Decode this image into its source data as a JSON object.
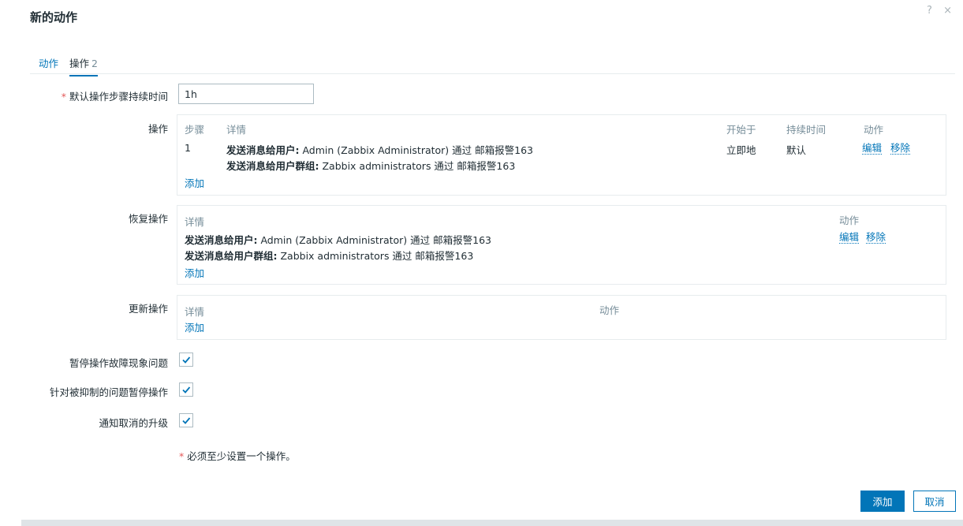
{
  "dialog": {
    "title": "新的动作",
    "help": "?",
    "close": "×"
  },
  "tabs": [
    {
      "label": "动作",
      "count": ""
    },
    {
      "label": "操作",
      "count": "2"
    }
  ],
  "fields": {
    "default_step_duration": {
      "label": "默认操作步骤持续时间",
      "required": "*",
      "value": "1h"
    }
  },
  "operations": {
    "label": "操作",
    "headers": [
      "步骤",
      "详情",
      "开始于",
      "持续时间",
      "动作"
    ],
    "row": {
      "step": "1",
      "detail1_bold": "发送消息给用户:",
      "detail1": " Admin (Zabbix Administrator) 通过 邮箱报警163",
      "detail2_bold": "发送消息给用户群组:",
      "detail2": " Zabbix administrators 通过 邮箱报警163",
      "start": "立即地",
      "duration": "默认",
      "edit": "编辑",
      "remove": "移除"
    },
    "add": "添加"
  },
  "recovery": {
    "label": "恢复操作",
    "headers": [
      "详情",
      "动作"
    ],
    "row": {
      "detail1_bold": "发送消息给用户:",
      "detail1": " Admin (Zabbix Administrator) 通过 邮箱报警163",
      "detail2_bold": "发送消息给用户群组:",
      "detail2": " Zabbix administrators 通过 邮箱报警163",
      "edit": "编辑",
      "remove": "移除"
    },
    "add": "添加"
  },
  "update": {
    "label": "更新操作",
    "headers": [
      "详情",
      "动作"
    ],
    "add": "添加"
  },
  "checkboxes": [
    {
      "label": "暂停操作故障现象问题",
      "checked": true
    },
    {
      "label": "针对被抑制的问题暂停操作",
      "checked": true
    },
    {
      "label": "通知取消的升级",
      "checked": true
    }
  ],
  "note": {
    "star": "*",
    "text": " 必须至少设置一个操作。"
  },
  "buttons": {
    "add": "添加",
    "cancel": "取消"
  },
  "colors": {
    "accent": "#0275b8",
    "required": "#e45959",
    "muted": "#768d99"
  }
}
